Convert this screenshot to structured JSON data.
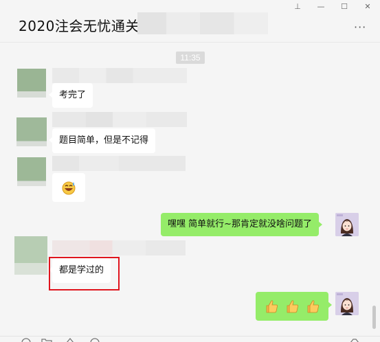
{
  "window": {
    "title": "2020注会无忧通关班",
    "pin_glyph": "⊥",
    "min_glyph": "—",
    "max_glyph": "☐",
    "close_glyph": "✕",
    "more_glyph": "···"
  },
  "chat": {
    "timestamp": "11:35",
    "messages": [
      {
        "side": "left",
        "kind": "text",
        "text": "考完了"
      },
      {
        "side": "left",
        "kind": "text",
        "text": "题目简单，但是不记得"
      },
      {
        "side": "left",
        "kind": "sticker",
        "icon": "grinning-sweat-emoji"
      },
      {
        "side": "right",
        "kind": "text",
        "text": "嘿嘿 简单就行~那肯定就没啥问题了"
      },
      {
        "side": "left",
        "kind": "text",
        "text": "都是学过的"
      },
      {
        "side": "right",
        "kind": "emoji",
        "icon": "thumbs-up-emoji",
        "count": 3
      }
    ]
  },
  "colors": {
    "self_bubble": "#95ec69",
    "other_bubble": "#ffffff",
    "highlight_border": "#e0141d",
    "background": "#f5f5f5"
  }
}
